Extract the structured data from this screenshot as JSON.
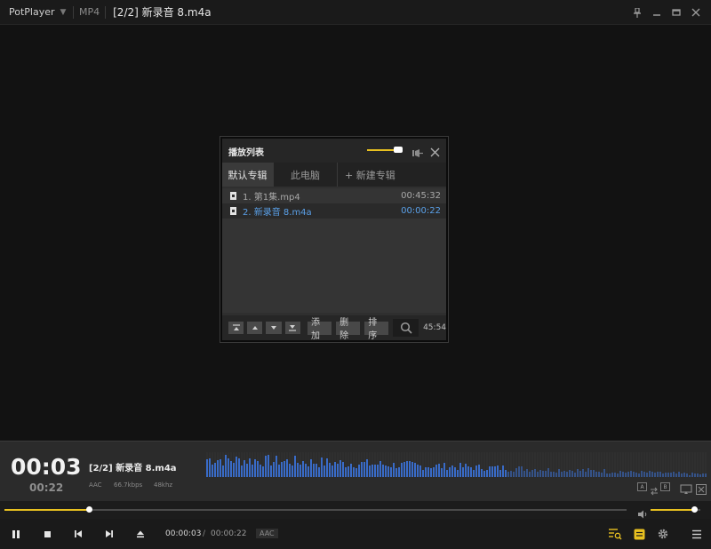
{
  "titlebar": {
    "app_name": "PotPlayer",
    "format": "MP4",
    "file_title": "[2/2] 新录音 8.m4a",
    "icons": [
      "chevron-down-icon",
      "pin-icon",
      "minimize-icon",
      "maximize-icon",
      "close-icon"
    ]
  },
  "playlist": {
    "title": "播放列表",
    "opacity_level": 0.75,
    "tabs": [
      {
        "label": "默认专辑",
        "active": true
      },
      {
        "label": "此电脑",
        "active": false
      },
      {
        "label": "+ 新建专辑",
        "active": false
      }
    ],
    "items": [
      {
        "name": "1. 第1集.mp4",
        "duration": "00:45:32",
        "selected": false
      },
      {
        "name": "2. 新录音 8.m4a",
        "duration": "00:00:22",
        "selected": true
      }
    ],
    "buttons": {
      "add": "添加",
      "delete": "删除",
      "sort": "排序"
    },
    "total_duration": "45:54"
  },
  "now_playing": {
    "current_time": "00:03",
    "total_time": "00:22",
    "title": "[2/2] 新录音 8.m4a",
    "codec": "AAC",
    "bitrate": "66.7kbps",
    "sample_rate": "48khz",
    "ab_buttons": [
      "A",
      "B"
    ]
  },
  "seek": {
    "progress": 0.136
  },
  "volume": {
    "level": 0.88
  },
  "controls": {
    "time_current": "00:00:03",
    "separator": "/",
    "time_total": "00:00:22",
    "codec_badge": "AAC"
  },
  "colors": {
    "accent": "#e8c020",
    "selected_text": "#5aa0e8",
    "spectrum": "#3a6fd0"
  }
}
